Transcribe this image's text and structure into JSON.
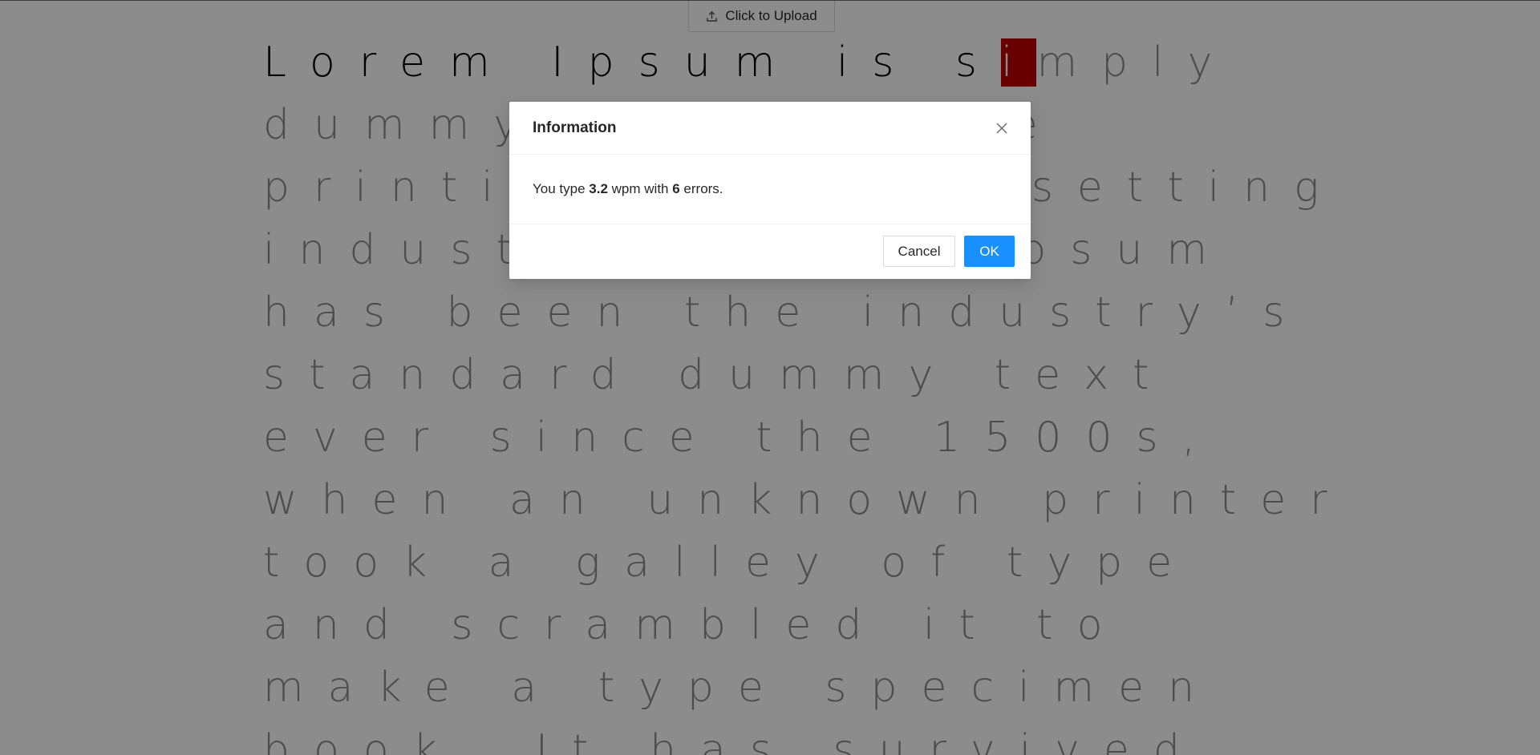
{
  "upload": {
    "label": "Click to Upload",
    "icon": "upload-icon"
  },
  "typing": {
    "typed": "Lorem Ipsum is s",
    "cursor": "i",
    "first_line_rest": "mply",
    "lines": [
      "dummy text of the",
      "printing and typesetting",
      "industry. Lorem Ipsum",
      "has been the industry’s",
      "standard dummy text",
      "ever since the 1500s,",
      "when an unknown printer",
      "took a galley of type",
      "and scrambled it to",
      "make a type specimen",
      "book. It has survived"
    ]
  },
  "modal": {
    "title": "Information",
    "message_prefix": "You type ",
    "wpm": "3.2",
    "message_middle": " wpm with ",
    "errors": "6",
    "message_suffix": " errors.",
    "cancel_label": "Cancel",
    "ok_label": "OK"
  },
  "colors": {
    "cursor_bg": "#c00000",
    "primary": "#1890ff",
    "untyped_text": "#8c8c8c",
    "typed_text": "#000000"
  }
}
